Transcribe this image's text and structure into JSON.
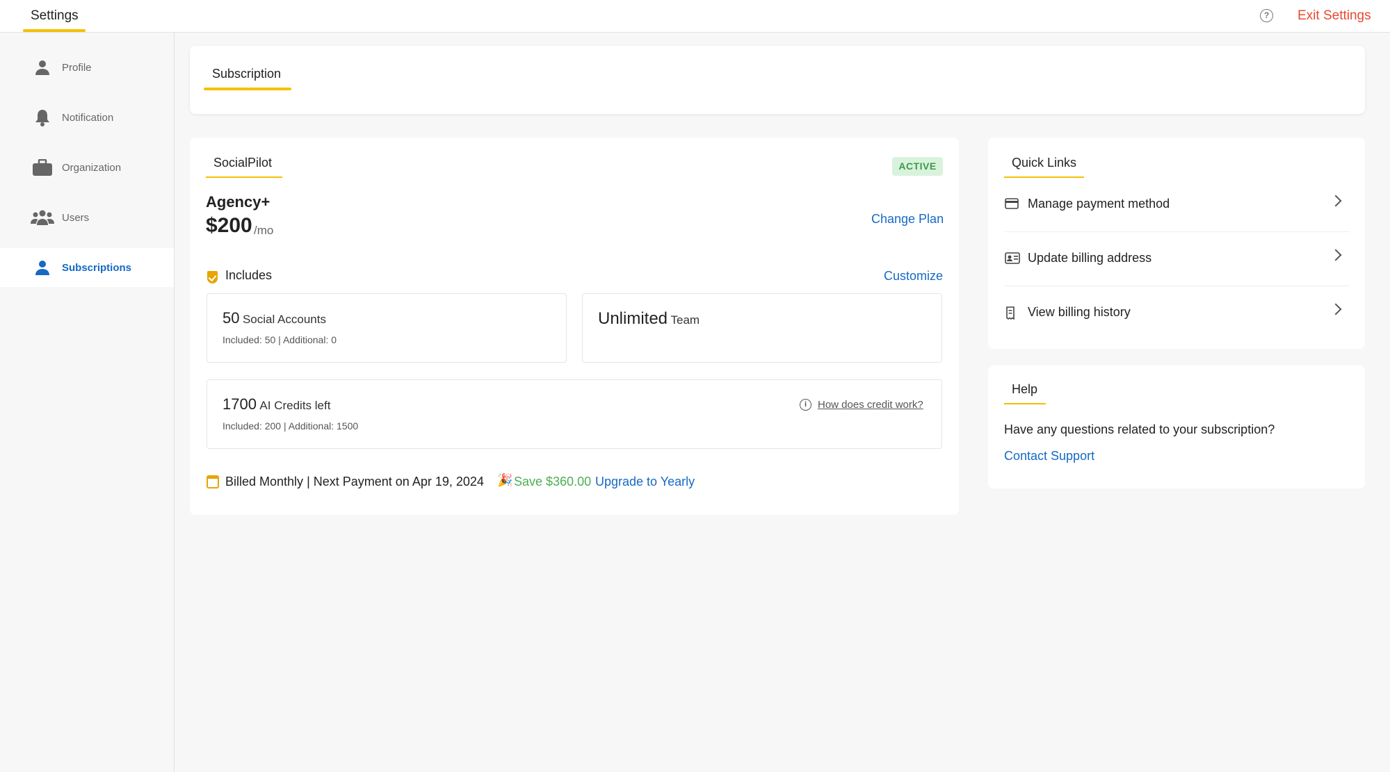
{
  "topbar": {
    "title": "Settings",
    "exit_label": "Exit Settings",
    "help_icon": "question-circle-icon"
  },
  "sidebar": {
    "items": [
      {
        "label": "Profile",
        "icon": "person-icon"
      },
      {
        "label": "Notification",
        "icon": "bell-icon"
      },
      {
        "label": "Organization",
        "icon": "briefcase-icon"
      },
      {
        "label": "Users",
        "icon": "users-icon"
      },
      {
        "label": "Subscriptions",
        "icon": "person-icon",
        "active": true
      }
    ]
  },
  "tabs": {
    "active": "Subscription"
  },
  "plan": {
    "provider": "SocialPilot",
    "status": "ACTIVE",
    "name": "Agency+",
    "price": "$200",
    "period": "/mo",
    "change_plan": "Change Plan",
    "includes_label": "Includes",
    "customize": "Customize",
    "social": {
      "count": "50",
      "label": "Social Accounts",
      "included_label": "Included:",
      "included": "50",
      "additional_label": "Additional:",
      "additional": "0"
    },
    "team": {
      "count": "Unlimited",
      "label": "Team"
    },
    "credits": {
      "count": "1700",
      "label": "AI Credits left",
      "included_label": "Included:",
      "included": "200",
      "additional_label": "Additional:",
      "additional": "1500",
      "help_link": "How does credit work?"
    },
    "billing": {
      "cycle": "Billed Monthly",
      "next_payment": "Next Payment on Apr 19, 2024",
      "save": "Save $360.00",
      "upgrade": "Upgrade to Yearly"
    }
  },
  "quick_links": {
    "title": "Quick Links",
    "items": [
      {
        "label": "Manage payment method",
        "icon": "credit-card-icon"
      },
      {
        "label": "Update billing address",
        "icon": "address-card-icon"
      },
      {
        "label": "View billing history",
        "icon": "receipt-icon"
      }
    ]
  },
  "help": {
    "title": "Help",
    "question": "Have any questions related to your subscription?",
    "contact": "Contact Support"
  },
  "colors": {
    "accent": "#f5c000",
    "link": "#1669c4",
    "exit": "#e8492e",
    "active_badge_bg": "#d9f2dc",
    "active_badge_text": "#3b9a4c",
    "save_text": "#4caf50"
  }
}
